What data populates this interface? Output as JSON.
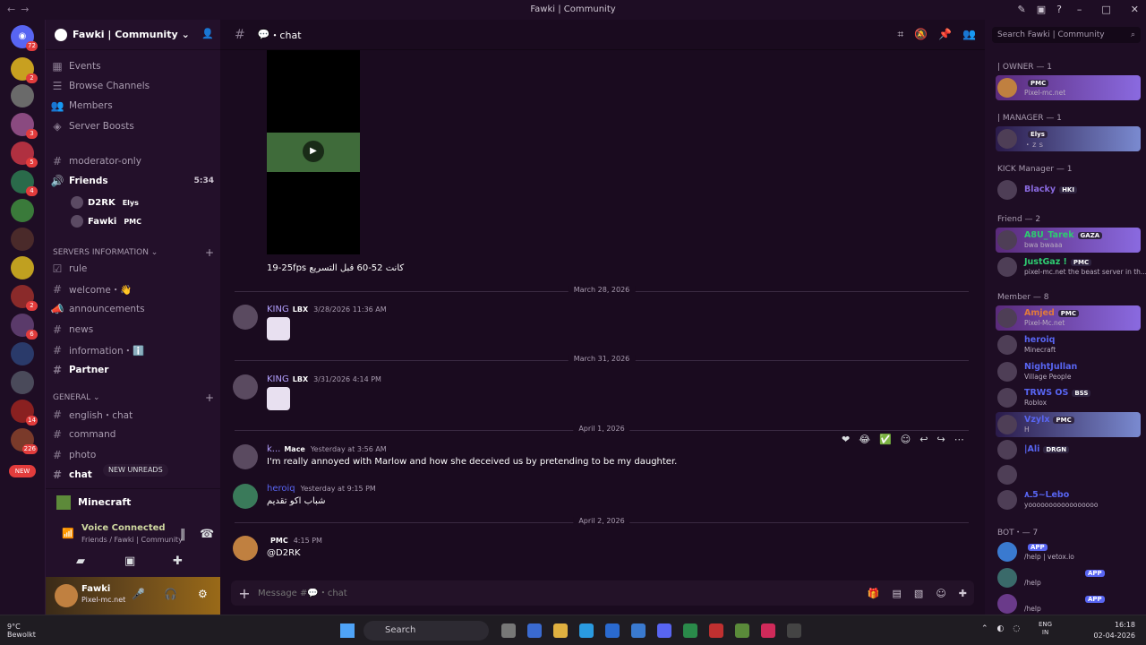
{
  "window": {
    "title": "Fawki | Community"
  },
  "guilds": {
    "badges": [
      "72",
      "2",
      "3",
      "5",
      "4",
      "2",
      "6",
      "14",
      "226"
    ],
    "new_label": "NEW"
  },
  "server": {
    "name": "Fawki | Community"
  },
  "channels": {
    "top": [
      "Events",
      "Browse Channels",
      "Members",
      "Server Boosts"
    ],
    "moderator": "moderator-only",
    "friends": {
      "name": "Friends",
      "time": "5:34"
    },
    "voice_users": [
      {
        "name": "D2RK",
        "tag": "Elys"
      },
      {
        "name": "Fawki",
        "tag": "PMC"
      }
    ],
    "cat_servers": "SERVERS INFORMATION",
    "servers_info": [
      "rule",
      "welcome・👋",
      "announcements",
      "news",
      "information・ℹ️",
      "Partner"
    ],
    "cat_general": "GENERAL",
    "general": [
      "english・chat",
      "command",
      "photo",
      "chat"
    ],
    "new_unreads": "NEW UNREADS"
  },
  "minecraft": {
    "label": "Minecraft"
  },
  "voice": {
    "status": "Voice Connected",
    "where": "Friends / Fawki | Community"
  },
  "user": {
    "name": "Fawki",
    "status": "Pixel-mc.net"
  },
  "header": {
    "channel": "・chat"
  },
  "messages": {
    "video_caption": "19-25fps كانت 52-60 قبل التسريع",
    "dates": [
      "March 28, 2026",
      "March 31, 2026",
      "April 1, 2026",
      "April 2, 2026"
    ],
    "m1": {
      "author": "KING",
      "role": "LBX",
      "time": "3/28/2026 11:36 AM"
    },
    "m2": {
      "author": "KING",
      "role": "LBX",
      "time": "3/31/2026 4:14 PM"
    },
    "m3": {
      "author": "k...",
      "role": "Mace",
      "time": "Yesterday at 3:56 AM",
      "body": "I'm really annoyed with Marlow and how she deceived us by pretending to be my daughter."
    },
    "m4": {
      "author": "heroiq",
      "time": "Yesterday at 9:15 PM",
      "body": "شباب اكو تقديم"
    },
    "m5": {
      "author": "",
      "role": "PMC",
      "time": "4:15 PM",
      "body": "@D2RK"
    }
  },
  "composer": {
    "placeholder": "Message #💬・chat"
  },
  "members": {
    "search_placeholder": "Search Fawki | Community",
    "groups": [
      {
        "label": "| OWNER — 1"
      },
      {
        "label": "| MANAGER — 1"
      },
      {
        "label": "KICK Manager — 1"
      },
      {
        "label": "Friend — 2"
      },
      {
        "label": "Member — 8"
      },
      {
        "label": "BOT・— 7"
      }
    ],
    "list": [
      {
        "name": "",
        "tag": "PMC",
        "status": "Pixel-mc.net",
        "color": "#e23c3c"
      },
      {
        "name": "",
        "tag": "Elys",
        "status": "・ｚｓ",
        "color": "#e23c3c"
      },
      {
        "name": "Blacky",
        "tag": "HKI",
        "status": "",
        "color": "#8a6ae0"
      },
      {
        "name": "A8U_Tarek",
        "tag": "GAZA",
        "status": "bwa bwaaa",
        "color": "#2ecc71"
      },
      {
        "name": "JustGaz !",
        "tag": "PMC",
        "status": "pixel-mc.net the beast server in th...",
        "color": "#2ecc71"
      },
      {
        "name": "Amjed",
        "tag": "PMC",
        "status": "Pixel-Mc.net",
        "color": "#e07a3c"
      },
      {
        "name": "heroiq",
        "tag": "",
        "status": "Minecraft",
        "color": "#5865f2"
      },
      {
        "name": "NightJullan",
        "tag": "",
        "status": "Village People",
        "color": "#5865f2"
      },
      {
        "name": "TRWS OS",
        "tag": "BSS",
        "status": "Roblox",
        "color": "#5865f2"
      },
      {
        "name": "Vzylx",
        "tag": "PMC",
        "status": "H",
        "color": "#5865f2"
      },
      {
        "name": "|Ali",
        "tag": "DRGN",
        "status": "",
        "color": "#5865f2"
      },
      {
        "name": "",
        "tag": "",
        "status": "",
        "color": "#5865f2"
      },
      {
        "name": "ـا~5ـ٨ebo",
        "tag": "",
        "status": "yooooooooooooooooo",
        "color": "#5865f2"
      },
      {
        "name": "",
        "tag": "APP",
        "status": "/help | vetox.io",
        "color": "#dbdee1"
      },
      {
        "name": "",
        "tag": "APP",
        "status": "/help",
        "color": "#dbdee1"
      },
      {
        "name": "",
        "tag": "APP",
        "status": "/help",
        "color": "#dbdee1"
      }
    ]
  },
  "taskbar": {
    "weather_temp": "9°C",
    "weather_desc": "Bewolkt",
    "search": "Search",
    "lang1": "ENG",
    "lang2": "IN",
    "time": "16:18",
    "date": "02-04-2026"
  }
}
